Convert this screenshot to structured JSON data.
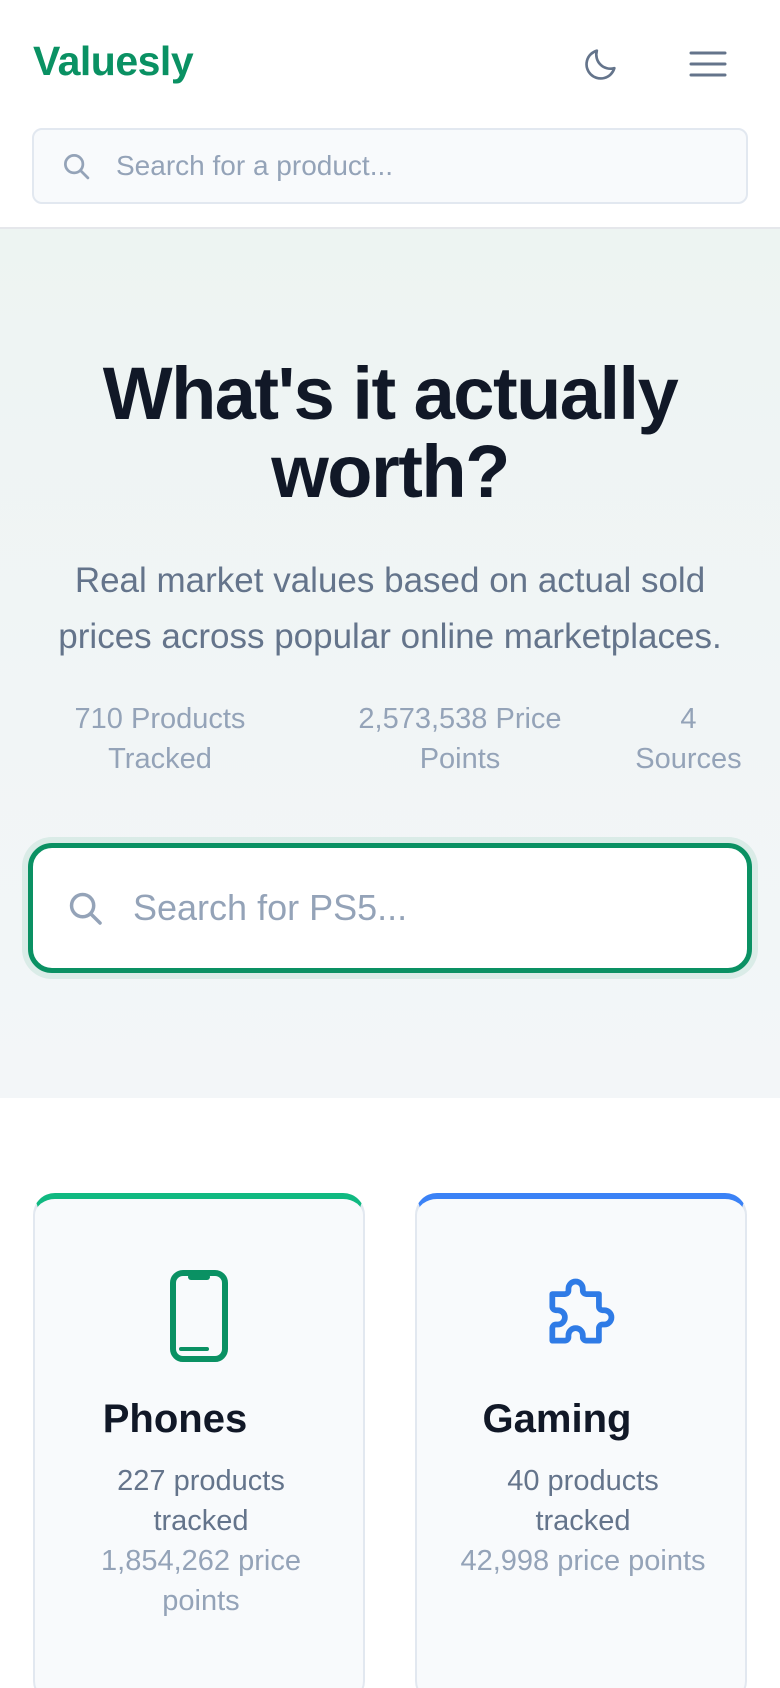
{
  "header": {
    "logo": "Valuesly",
    "theme_icon": "moon-icon",
    "menu_icon": "hamburger-menu-icon",
    "search": {
      "placeholder": "Search for a product...",
      "icon": "search-icon"
    }
  },
  "hero": {
    "title": "What's it actually worth?",
    "subtitle": "Real market values based on actual sold prices across popular online marketplaces.",
    "stats": [
      {
        "label": "710 Products Tracked"
      },
      {
        "label": "2,573,538 Price Points"
      },
      {
        "label": "4 Sources"
      }
    ],
    "search": {
      "placeholder": "Search for PS5...",
      "icon": "search-icon"
    }
  },
  "categories": [
    {
      "title": "Phones",
      "icon": "phone-icon",
      "products": "227 products tracked",
      "price_points": "1,854,262 price points",
      "accent": "#10b981",
      "icon_color": "#0a9163"
    },
    {
      "title": "Gaming",
      "icon": "puzzle-icon",
      "products": "40 products tracked",
      "price_points": "42,998 price points",
      "accent": "#3b82f6",
      "icon_color": "#2f7be6"
    }
  ],
  "colors": {
    "brand": "#0a9163",
    "heading": "#111827",
    "muted": "#64748b",
    "subtle": "#94a3b8"
  }
}
